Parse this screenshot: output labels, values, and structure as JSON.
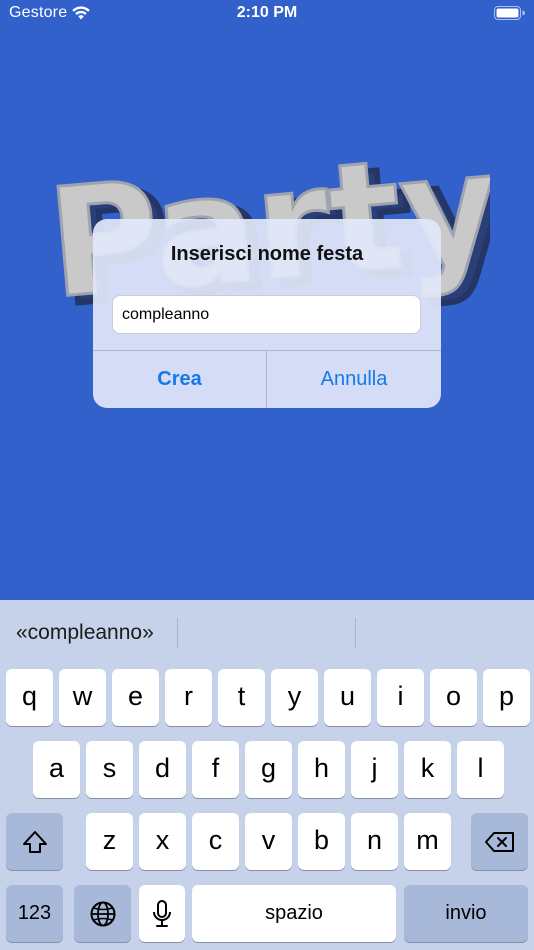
{
  "status_bar": {
    "carrier": "Gestore",
    "time": "2:10 PM"
  },
  "background": {
    "logo_text": "Party",
    "color": "#3261CB"
  },
  "alert": {
    "title": "Inserisci nome festa",
    "input_value": "compleanno",
    "confirm_label": "Crea",
    "cancel_label": "Annulla",
    "button_color": "#1778E8"
  },
  "keyboard": {
    "suggestions": [
      "«compleanno»",
      "",
      ""
    ],
    "row1": [
      "q",
      "w",
      "e",
      "r",
      "t",
      "y",
      "u",
      "i",
      "o",
      "p"
    ],
    "row2": [
      "a",
      "s",
      "d",
      "f",
      "g",
      "h",
      "j",
      "k",
      "l"
    ],
    "row3": [
      "z",
      "x",
      "c",
      "v",
      "b",
      "n",
      "m"
    ],
    "numbers_label": "123",
    "space_label": "spazio",
    "return_label": "invio",
    "shift_icon": "shift-icon",
    "delete_icon": "delete-icon",
    "globe_icon": "globe-icon",
    "mic_icon": "microphone-icon"
  }
}
